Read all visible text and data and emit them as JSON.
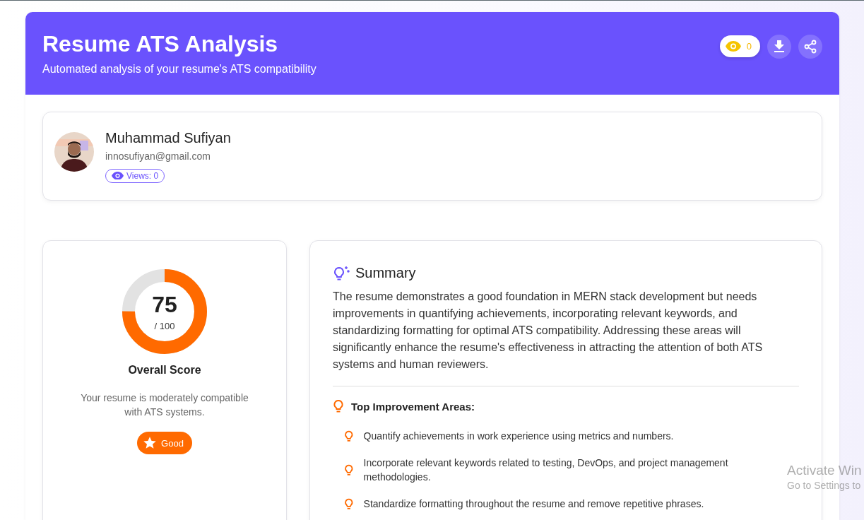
{
  "header": {
    "title": "Resume ATS Analysis",
    "subtitle": "Automated analysis of your resume's ATS compatibility",
    "view_count": "0"
  },
  "profile": {
    "name": "Muhammad Sufiyan",
    "email": "innosufiyan@gmail.com",
    "views": "Views: 0"
  },
  "score": {
    "value": "75",
    "max": "/ 100",
    "label": "Overall Score",
    "description": "Your resume is moderately compatible with ATS systems.",
    "rating": "Good"
  },
  "summary": {
    "title": "Summary",
    "text": "The resume demonstrates a good foundation in MERN stack development but needs improvements in quantifying achievements, incorporating relevant keywords, and standardizing formatting for optimal ATS compatibility. Addressing these areas will significantly enhance the resume's effectiveness in attracting the attention of both ATS systems and human reviewers.",
    "improvements_title": "Top Improvement Areas:",
    "improvements": [
      "Quantify achievements in work experience using metrics and numbers.",
      "Incorporate relevant keywords related to testing, DevOps, and project management methodologies.",
      "Standardize formatting throughout the resume and remove repetitive phrases."
    ]
  },
  "os_notice": {
    "title": "Activate Win",
    "subtitle": "Go to Settings to"
  }
}
